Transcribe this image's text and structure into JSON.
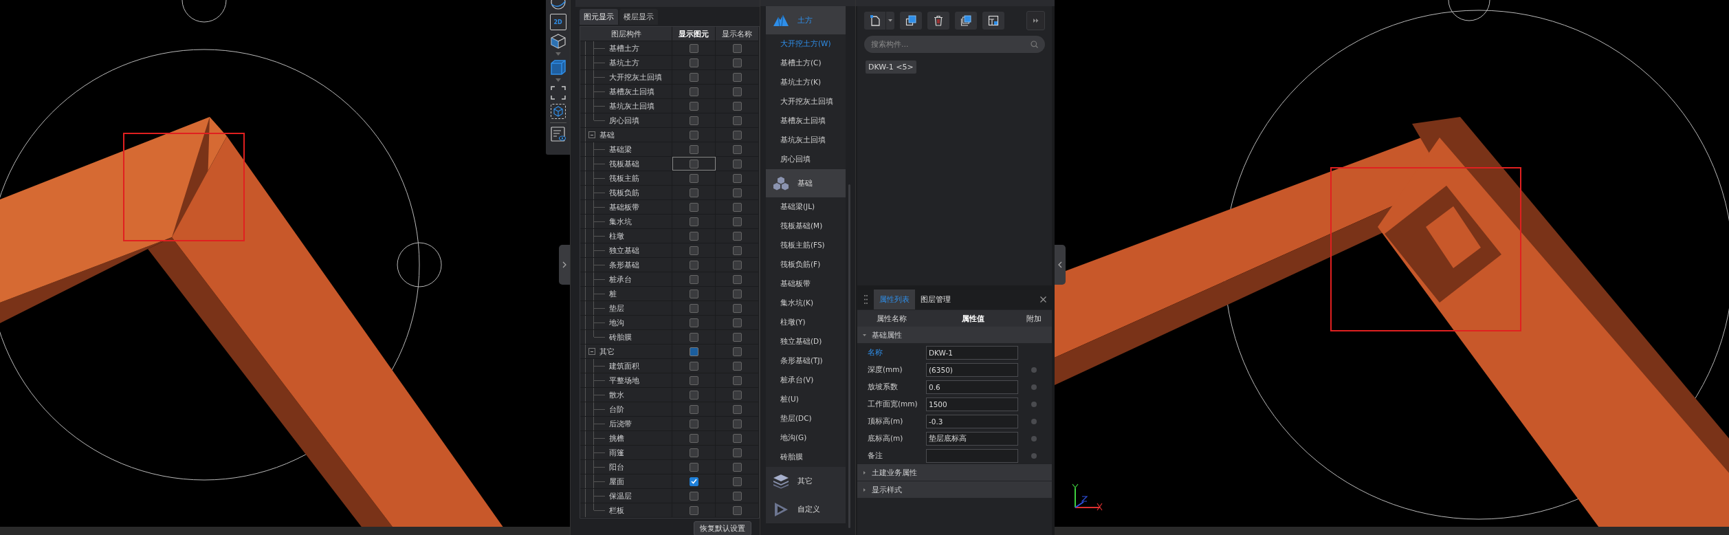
{
  "view_toolbar": {
    "plan_label": "2D"
  },
  "layer_panel": {
    "tabs": [
      {
        "label": "图元显示",
        "selected": true
      },
      {
        "label": "楼层显示",
        "selected": false
      }
    ],
    "columns": [
      "图层构件",
      "显示图元",
      "显示名称"
    ],
    "continued_items": [
      {
        "label": "基槽土方",
        "show_element": false,
        "show_name": false,
        "focused": false
      },
      {
        "label": "基坑土方",
        "show_element": false,
        "show_name": false,
        "focused": false
      },
      {
        "label": "大开挖灰土回填",
        "show_element": false,
        "show_name": false,
        "focused": false
      },
      {
        "label": "基槽灰土回填",
        "show_element": false,
        "show_name": false,
        "focused": false
      },
      {
        "label": "基坑灰土回填",
        "show_element": false,
        "show_name": false,
        "focused": false
      },
      {
        "label": "房心回填",
        "show_element": false,
        "show_name": false,
        "focused": false
      }
    ],
    "groups": [
      {
        "label": "基础",
        "expanded": true,
        "show_element": false,
        "partial": false,
        "show_name": false,
        "children": [
          {
            "label": "基础梁",
            "show_element": false,
            "show_name": false,
            "focused": false
          },
          {
            "label": "筏板基础",
            "show_element": false,
            "show_name": false,
            "focused": true
          },
          {
            "label": "筏板主筋",
            "show_element": false,
            "show_name": false,
            "focused": false
          },
          {
            "label": "筏板负筋",
            "show_element": false,
            "show_name": false,
            "focused": false
          },
          {
            "label": "基础板带",
            "show_element": false,
            "show_name": false,
            "focused": false
          },
          {
            "label": "集水坑",
            "show_element": false,
            "show_name": false,
            "focused": false
          },
          {
            "label": "柱墩",
            "show_element": false,
            "show_name": false,
            "focused": false
          },
          {
            "label": "独立基础",
            "show_element": false,
            "show_name": false,
            "focused": false
          },
          {
            "label": "条形基础",
            "show_element": false,
            "show_name": false,
            "focused": false
          },
          {
            "label": "桩承台",
            "show_element": false,
            "show_name": false,
            "focused": false
          },
          {
            "label": "桩",
            "show_element": false,
            "show_name": false,
            "focused": false
          },
          {
            "label": "垫层",
            "show_element": false,
            "show_name": false,
            "focused": false
          },
          {
            "label": "地沟",
            "show_element": false,
            "show_name": false,
            "focused": false
          },
          {
            "label": "砖胎膜",
            "show_element": false,
            "show_name": false,
            "focused": false
          }
        ]
      },
      {
        "label": "其它",
        "expanded": true,
        "show_element": false,
        "partial": true,
        "show_name": false,
        "children": [
          {
            "label": "建筑面积",
            "show_element": false,
            "show_name": false,
            "focused": false
          },
          {
            "label": "平整场地",
            "show_element": false,
            "show_name": false,
            "focused": false
          },
          {
            "label": "散水",
            "show_element": false,
            "show_name": false,
            "focused": false
          },
          {
            "label": "台阶",
            "show_element": false,
            "show_name": false,
            "focused": false
          },
          {
            "label": "后浇带",
            "show_element": false,
            "show_name": false,
            "focused": false
          },
          {
            "label": "挑檐",
            "show_element": false,
            "show_name": false,
            "focused": false
          },
          {
            "label": "雨篷",
            "show_element": false,
            "show_name": false,
            "focused": false
          },
          {
            "label": "阳台",
            "show_element": false,
            "show_name": false,
            "focused": false
          },
          {
            "label": "屋面",
            "show_element": true,
            "show_name": false,
            "focused": false
          },
          {
            "label": "保温层",
            "show_element": false,
            "show_name": false,
            "focused": false
          },
          {
            "label": "栏板",
            "show_element": false,
            "show_name": false,
            "focused": false
          }
        ]
      }
    ],
    "reset_button": "恢复默认设置"
  },
  "category_panel": {
    "categories": [
      {
        "label": "土方",
        "selected": true,
        "items": [
          {
            "label": "大开挖土方(W)",
            "selected": true
          },
          {
            "label": "基槽土方(C)",
            "selected": false
          },
          {
            "label": "基坑土方(K)",
            "selected": false
          },
          {
            "label": "大开挖灰土回填",
            "selected": false
          },
          {
            "label": "基槽灰土回填",
            "selected": false
          },
          {
            "label": "基坑灰土回填",
            "selected": false
          },
          {
            "label": "房心回填",
            "selected": false
          }
        ]
      },
      {
        "label": "基础",
        "selected": false,
        "items": [
          {
            "label": "基础梁(JL)",
            "selected": false
          },
          {
            "label": "筏板基础(M)",
            "selected": false
          },
          {
            "label": "筏板主筋(FS)",
            "selected": false
          },
          {
            "label": "筏板负筋(F)",
            "selected": false
          },
          {
            "label": "基础板带",
            "selected": false
          },
          {
            "label": "集水坑(K)",
            "selected": false
          },
          {
            "label": "柱墩(Y)",
            "selected": false
          },
          {
            "label": "独立基础(D)",
            "selected": false
          },
          {
            "label": "条形基础(TJ)",
            "selected": false
          },
          {
            "label": "桩承台(V)",
            "selected": false
          },
          {
            "label": "桩(U)",
            "selected": false
          },
          {
            "label": "垫层(DC)",
            "selected": false
          },
          {
            "label": "地沟(G)",
            "selected": false
          },
          {
            "label": "砖胎膜",
            "selected": false
          }
        ]
      },
      {
        "label": "其它",
        "selected": false
      },
      {
        "label": "自定义",
        "selected": false
      }
    ]
  },
  "component_panel": {
    "search": {
      "placeholder": "搜索构件..."
    },
    "components": [
      {
        "label": "DKW-1 <5>"
      }
    ]
  },
  "property_panel": {
    "tabs": [
      {
        "label": "属性列表",
        "selected": true
      },
      {
        "label": "图层管理",
        "selected": false
      }
    ],
    "columns": [
      "属性名称",
      "属性值",
      "附加"
    ],
    "sections": [
      {
        "label": "基础属性",
        "expanded": true,
        "rows": [
          {
            "name": "名称",
            "value": "DKW-1",
            "highlighted": true,
            "attach": false
          },
          {
            "name": "深度(mm)",
            "value": "(6350)",
            "highlighted": false,
            "attach": true
          },
          {
            "name": "放坡系数",
            "value": "0.6",
            "highlighted": false,
            "attach": true
          },
          {
            "name": "工作面宽(mm)",
            "value": "1500",
            "highlighted": false,
            "attach": true
          },
          {
            "name": "顶标高(m)",
            "value": "-0.3",
            "highlighted": false,
            "attach": true
          },
          {
            "name": "底标高(m)",
            "value": "垫层底标高",
            "highlighted": false,
            "attach": true
          },
          {
            "name": "备注",
            "value": "",
            "highlighted": false,
            "attach": true
          }
        ]
      },
      {
        "label": "土建业务属性",
        "expanded": false
      },
      {
        "label": "显示样式",
        "expanded": false
      }
    ]
  }
}
